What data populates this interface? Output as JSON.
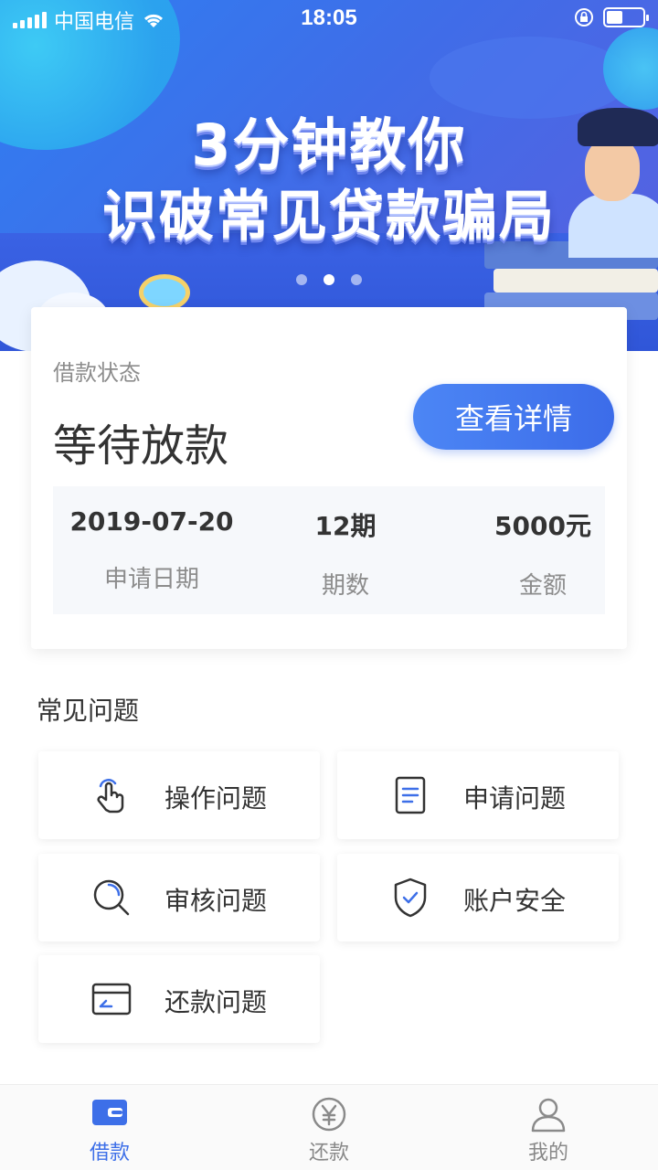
{
  "status_bar": {
    "carrier": "中国电信",
    "time": "18:05"
  },
  "banner": {
    "headline_line1": "3分钟教你",
    "headline_line2": "识破常见贷款骗局",
    "page_count": 3,
    "active_page": 2
  },
  "loan_card": {
    "label": "借款状态",
    "status": "等待放款",
    "detail_button": "查看详情",
    "info": [
      {
        "value": "2019-07-20",
        "key": "申请日期"
      },
      {
        "value": "12期",
        "key": "期数"
      },
      {
        "value": "5000元",
        "key": "金额"
      }
    ]
  },
  "faq": {
    "title": "常见问题",
    "items": [
      {
        "label": "操作问题",
        "icon": "tap-hand-icon"
      },
      {
        "label": "申请问题",
        "icon": "document-icon"
      },
      {
        "label": "审核问题",
        "icon": "search-icon"
      },
      {
        "label": "账户安全",
        "icon": "shield-check-icon"
      },
      {
        "label": "还款问题",
        "icon": "card-icon"
      }
    ]
  },
  "tabbar": {
    "tabs": [
      {
        "label": "借款",
        "icon": "wallet-icon",
        "active": true
      },
      {
        "label": "还款",
        "icon": "yen-icon",
        "active": false
      },
      {
        "label": "我的",
        "icon": "user-icon",
        "active": false
      }
    ]
  },
  "colors": {
    "accent": "#3d6fe8",
    "banner_start": "#2f7ff2",
    "banner_end": "#5a5fe0",
    "info_bg": "#f6f8fb"
  }
}
